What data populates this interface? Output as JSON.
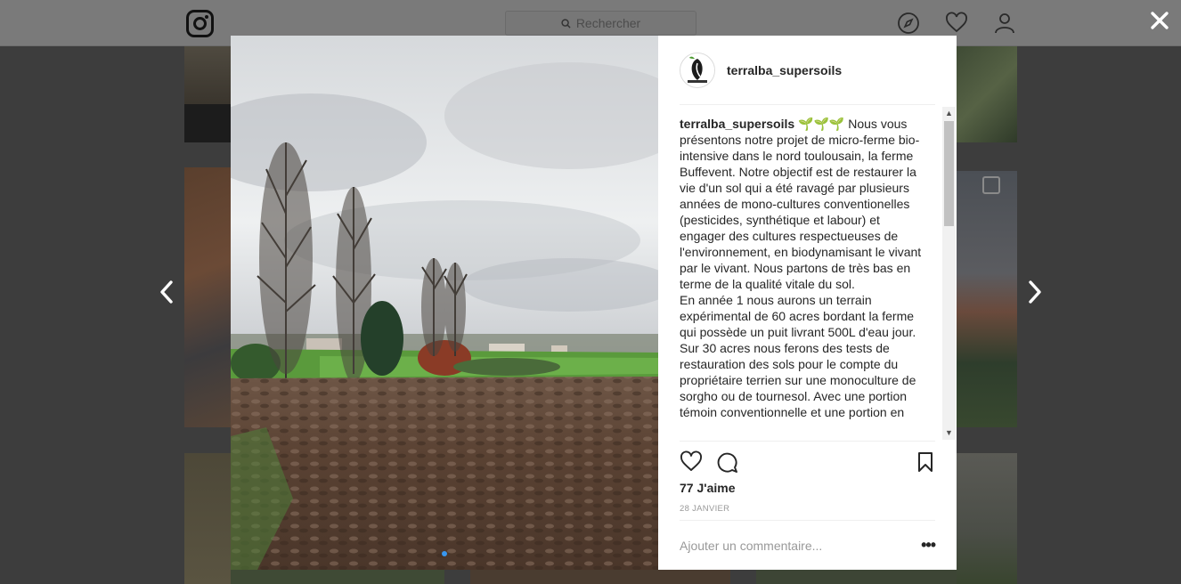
{
  "background": {
    "search_placeholder": "Rechercher",
    "icons": [
      "instagram-logo",
      "compass-icon",
      "heart-icon",
      "user-icon"
    ]
  },
  "overlay": {
    "close_icon": "close-icon",
    "prev_icon": "chevron-left-icon",
    "next_icon": "chevron-right-icon"
  },
  "post": {
    "username": "terralba_supersoils",
    "caption_user": "terralba_supersoils",
    "caption_emoji": "🌱🌱🌱",
    "caption_text": " Nous vous présentons notre projet de micro-ferme bio-intensive dans le nord toulousain, la ferme Buffevent. Notre objectif est de restaurer la vie d'un sol qui a été ravagé par plusieurs années de mono-cultures conventionelles (pesticides, synthétique et labour) et engager des cultures respectueuses de l'environnement, en biodynamisant le vivant par le vivant. Nous partons de très bas en terme de la qualité vitale du sol.\nEn année 1 nous aurons un terrain expérimental de 60 acres bordant la ferme qui possède un puit livrant 500L d'eau jour. Sur 30 acres nous ferons des tests de restauration des sols pour le compte du propriétaire terrien sur une monoculture de sorgho ou de tournesol. Avec une portion témoin conventionnelle et une portion en",
    "likes": "77 J'aime",
    "date": "28 JANVIER",
    "comment_placeholder": "Ajouter un commentaire...",
    "more_label": "•••",
    "carousel_pages": 2,
    "carousel_active": 1
  },
  "colors": {
    "accent": "#3897f0",
    "text": "#262626",
    "muted": "#999999"
  }
}
